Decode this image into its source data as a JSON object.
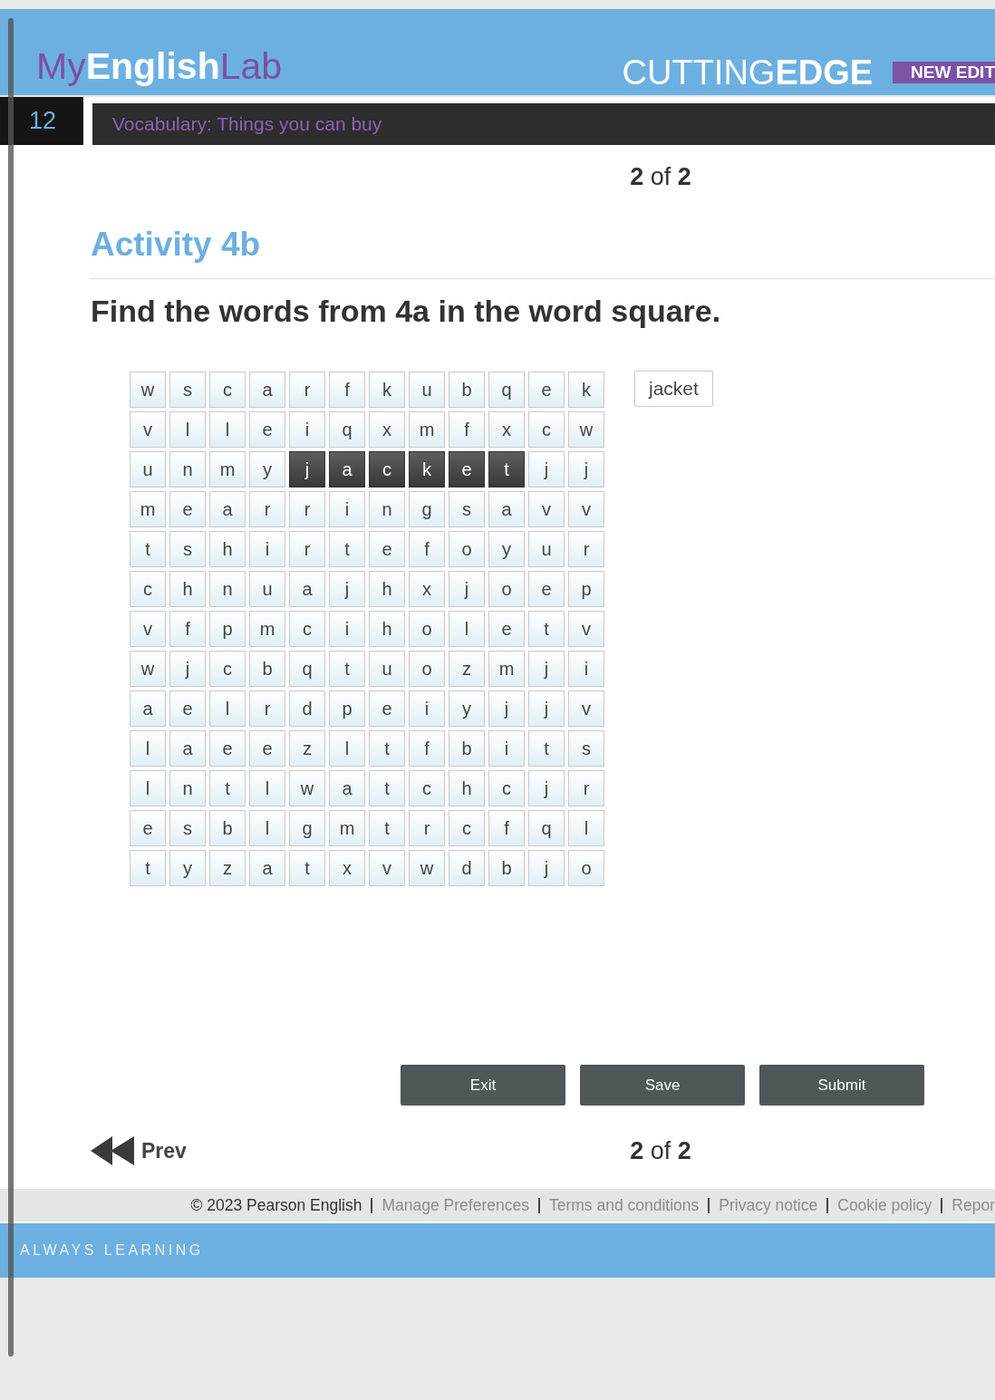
{
  "header": {
    "logo": [
      {
        "text": "My",
        "kind": "accent"
      },
      {
        "text": "English",
        "kind": "plain"
      },
      {
        "text": "Lab",
        "kind": "accent"
      }
    ],
    "brand": "CUTTING**EDGE**",
    "badge": "NEW EDIT"
  },
  "unit_bar": {
    "number": "12",
    "title": "Vocabulary: Things you can buy"
  },
  "page_counter_top": "**2** of **2**",
  "activity": {
    "title": "Activity 4b",
    "instruction": "Find the words from 4a in the word square."
  },
  "word_square": {
    "rows": [
      [
        {
          "letter": "w",
          "selected": false
        },
        {
          "letter": "s",
          "selected": false
        },
        {
          "letter": "c",
          "selected": false
        },
        {
          "letter": "a",
          "selected": false
        },
        {
          "letter": "r",
          "selected": false
        },
        {
          "letter": "f",
          "selected": false
        },
        {
          "letter": "k",
          "selected": false
        },
        {
          "letter": "u",
          "selected": false
        },
        {
          "letter": "b",
          "selected": false
        },
        {
          "letter": "q",
          "selected": false
        },
        {
          "letter": "e",
          "selected": false
        },
        {
          "letter": "k",
          "selected": false
        }
      ],
      [
        {
          "letter": "v",
          "selected": false
        },
        {
          "letter": "l",
          "selected": false
        },
        {
          "letter": "l",
          "selected": false
        },
        {
          "letter": "e",
          "selected": false
        },
        {
          "letter": "i",
          "selected": false
        },
        {
          "letter": "q",
          "selected": false
        },
        {
          "letter": "x",
          "selected": false
        },
        {
          "letter": "m",
          "selected": false
        },
        {
          "letter": "f",
          "selected": false
        },
        {
          "letter": "x",
          "selected": false
        },
        {
          "letter": "c",
          "selected": false
        },
        {
          "letter": "w",
          "selected": false
        }
      ],
      [
        {
          "letter": "u",
          "selected": false
        },
        {
          "letter": "n",
          "selected": false
        },
        {
          "letter": "m",
          "selected": false
        },
        {
          "letter": "y",
          "selected": false
        },
        {
          "letter": "j",
          "selected": true
        },
        {
          "letter": "a",
          "selected": true
        },
        {
          "letter": "c",
          "selected": true
        },
        {
          "letter": "k",
          "selected": true
        },
        {
          "letter": "e",
          "selected": true
        },
        {
          "letter": "t",
          "selected": true
        },
        {
          "letter": "j",
          "selected": false
        },
        {
          "letter": "j",
          "selected": false
        }
      ],
      [
        {
          "letter": "m",
          "selected": false
        },
        {
          "letter": "e",
          "selected": false
        },
        {
          "letter": "a",
          "selected": false
        },
        {
          "letter": "r",
          "selected": false
        },
        {
          "letter": "r",
          "selected": false
        },
        {
          "letter": "i",
          "selected": false
        },
        {
          "letter": "n",
          "selected": false
        },
        {
          "letter": "g",
          "selected": false
        },
        {
          "letter": "s",
          "selected": false
        },
        {
          "letter": "a",
          "selected": false
        },
        {
          "letter": "v",
          "selected": false
        },
        {
          "letter": "v",
          "selected": false
        }
      ],
      [
        {
          "letter": "t",
          "selected": false
        },
        {
          "letter": "s",
          "selected": false
        },
        {
          "letter": "h",
          "selected": false
        },
        {
          "letter": "i",
          "selected": false
        },
        {
          "letter": "r",
          "selected": false
        },
        {
          "letter": "t",
          "selected": false
        },
        {
          "letter": "e",
          "selected": false
        },
        {
          "letter": "f",
          "selected": false
        },
        {
          "letter": "o",
          "selected": false
        },
        {
          "letter": "y",
          "selected": false
        },
        {
          "letter": "u",
          "selected": false
        },
        {
          "letter": "r",
          "selected": false
        }
      ],
      [
        {
          "letter": "c",
          "selected": false
        },
        {
          "letter": "h",
          "selected": false
        },
        {
          "letter": "n",
          "selected": false
        },
        {
          "letter": "u",
          "selected": false
        },
        {
          "letter": "a",
          "selected": false
        },
        {
          "letter": "j",
          "selected": false
        },
        {
          "letter": "h",
          "selected": false
        },
        {
          "letter": "x",
          "selected": false
        },
        {
          "letter": "j",
          "selected": false
        },
        {
          "letter": "o",
          "selected": false
        },
        {
          "letter": "e",
          "selected": false
        },
        {
          "letter": "p",
          "selected": false
        }
      ],
      [
        {
          "letter": "v",
          "selected": false
        },
        {
          "letter": "f",
          "selected": false
        },
        {
          "letter": "p",
          "selected": false
        },
        {
          "letter": "m",
          "selected": false
        },
        {
          "letter": "c",
          "selected": false
        },
        {
          "letter": "i",
          "selected": false
        },
        {
          "letter": "h",
          "selected": false
        },
        {
          "letter": "o",
          "selected": false
        },
        {
          "letter": "l",
          "selected": false
        },
        {
          "letter": "e",
          "selected": false
        },
        {
          "letter": "t",
          "selected": false
        },
        {
          "letter": "v",
          "selected": false
        }
      ],
      [
        {
          "letter": "w",
          "selected": false
        },
        {
          "letter": "j",
          "selected": false
        },
        {
          "letter": "c",
          "selected": false
        },
        {
          "letter": "b",
          "selected": false
        },
        {
          "letter": "q",
          "selected": false
        },
        {
          "letter": "t",
          "selected": false
        },
        {
          "letter": "u",
          "selected": false
        },
        {
          "letter": "o",
          "selected": false
        },
        {
          "letter": "z",
          "selected": false
        },
        {
          "letter": "m",
          "selected": false
        },
        {
          "letter": "j",
          "selected": false
        },
        {
          "letter": "i",
          "selected": false
        }
      ],
      [
        {
          "letter": "a",
          "selected": false
        },
        {
          "letter": "e",
          "selected": false
        },
        {
          "letter": "l",
          "selected": false
        },
        {
          "letter": "r",
          "selected": false
        },
        {
          "letter": "d",
          "selected": false
        },
        {
          "letter": "p",
          "selected": false
        },
        {
          "letter": "e",
          "selected": false
        },
        {
          "letter": "i",
          "selected": false
        },
        {
          "letter": "y",
          "selected": false
        },
        {
          "letter": "j",
          "selected": false
        },
        {
          "letter": "j",
          "selected": false
        },
        {
          "letter": "v",
          "selected": false
        }
      ],
      [
        {
          "letter": "l",
          "selected": false
        },
        {
          "letter": "a",
          "selected": false
        },
        {
          "letter": "e",
          "selected": false
        },
        {
          "letter": "e",
          "selected": false
        },
        {
          "letter": "z",
          "selected": false
        },
        {
          "letter": "l",
          "selected": false
        },
        {
          "letter": "t",
          "selected": false
        },
        {
          "letter": "f",
          "selected": false
        },
        {
          "letter": "b",
          "selected": false
        },
        {
          "letter": "i",
          "selected": false
        },
        {
          "letter": "t",
          "selected": false
        },
        {
          "letter": "s",
          "selected": false
        }
      ],
      [
        {
          "letter": "l",
          "selected": false
        },
        {
          "letter": "n",
          "selected": false
        },
        {
          "letter": "t",
          "selected": false
        },
        {
          "letter": "l",
          "selected": false
        },
        {
          "letter": "w",
          "selected": false
        },
        {
          "letter": "a",
          "selected": false
        },
        {
          "letter": "t",
          "selected": false
        },
        {
          "letter": "c",
          "selected": false
        },
        {
          "letter": "h",
          "selected": false
        },
        {
          "letter": "c",
          "selected": false
        },
        {
          "letter": "j",
          "selected": false
        },
        {
          "letter": "r",
          "selected": false
        }
      ],
      [
        {
          "letter": "e",
          "selected": false
        },
        {
          "letter": "s",
          "selected": false
        },
        {
          "letter": "b",
          "selected": false
        },
        {
          "letter": "l",
          "selected": false
        },
        {
          "letter": "g",
          "selected": false
        },
        {
          "letter": "m",
          "selected": false
        },
        {
          "letter": "t",
          "selected": false
        },
        {
          "letter": "r",
          "selected": false
        },
        {
          "letter": "c",
          "selected": false
        },
        {
          "letter": "f",
          "selected": false
        },
        {
          "letter": "q",
          "selected": false
        },
        {
          "letter": "l",
          "selected": false
        }
      ],
      [
        {
          "letter": "t",
          "selected": false
        },
        {
          "letter": "y",
          "selected": false
        },
        {
          "letter": "z",
          "selected": false
        },
        {
          "letter": "a",
          "selected": false
        },
        {
          "letter": "t",
          "selected": false
        },
        {
          "letter": "x",
          "selected": false
        },
        {
          "letter": "v",
          "selected": false
        },
        {
          "letter": "w",
          "selected": false
        },
        {
          "letter": "d",
          "selected": false
        },
        {
          "letter": "b",
          "selected": false
        },
        {
          "letter": "j",
          "selected": false
        },
        {
          "letter": "o",
          "selected": false
        }
      ]
    ]
  },
  "found_words": [
    "jacket"
  ],
  "buttons": [
    "Exit",
    "Save",
    "Submit"
  ],
  "pager": {
    "prev": "Prev",
    "counter": "**2** of **2**"
  },
  "footer": {
    "copyright": "© 2023 Pearson English",
    "links": [
      "Manage Preferences",
      "Terms and conditions",
      "Privacy notice",
      "Cookie policy",
      "Repor"
    ]
  },
  "tagline": "ALWAYS LEARNING"
}
